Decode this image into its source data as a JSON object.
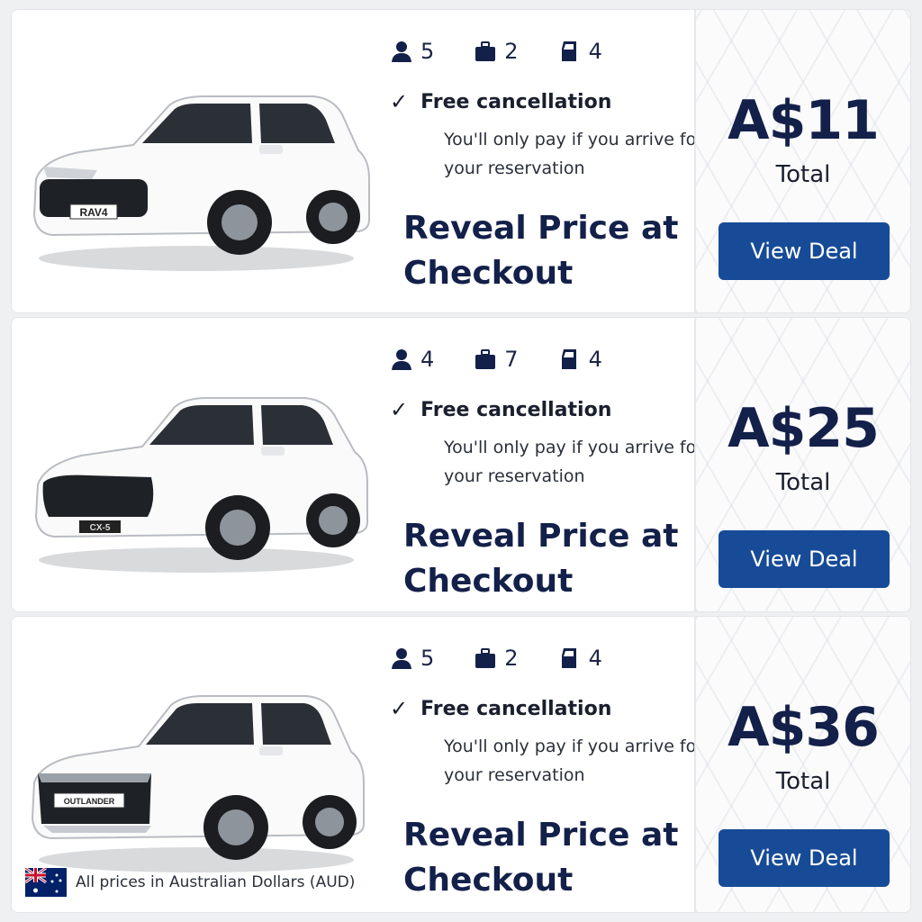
{
  "colors": {
    "accent": "#174b97",
    "text_dark": "#13204a",
    "card_bg": "#ffffff"
  },
  "icons": {
    "passengers": "person-icon",
    "bags": "suitcase-icon",
    "doors": "car-door-icon",
    "cancel": "checkmark-icon"
  },
  "cards": [
    {
      "car_badge": "RAV4",
      "passengers": "5",
      "bags": "2",
      "doors": "4",
      "cancel_title": "Free cancellation",
      "cancel_sub": "You'll only pay if you arrive for your reservation",
      "reveal": "Reveal Price at Checkout",
      "price": "A$11",
      "price_label": "Total",
      "button": "View Deal"
    },
    {
      "car_badge": "CX-5",
      "passengers": "4",
      "bags": "7",
      "doors": "4",
      "cancel_title": "Free cancellation",
      "cancel_sub": "You'll only pay if you arrive for your reservation",
      "reveal": "Reveal Price at Checkout",
      "price": "A$25",
      "price_label": "Total",
      "button": "View Deal"
    },
    {
      "car_badge": "OUTLANDER",
      "passengers": "5",
      "bags": "2",
      "doors": "4",
      "cancel_title": "Free cancellation",
      "cancel_sub": "You'll only pay if you arrive for your reservation",
      "reveal": "Reveal Price at Checkout",
      "price": "A$36",
      "price_label": "Total",
      "button": "View Deal"
    }
  ],
  "footer": {
    "note": "All prices in Australian Dollars (AUD)",
    "flag": "australia-flag-icon"
  }
}
